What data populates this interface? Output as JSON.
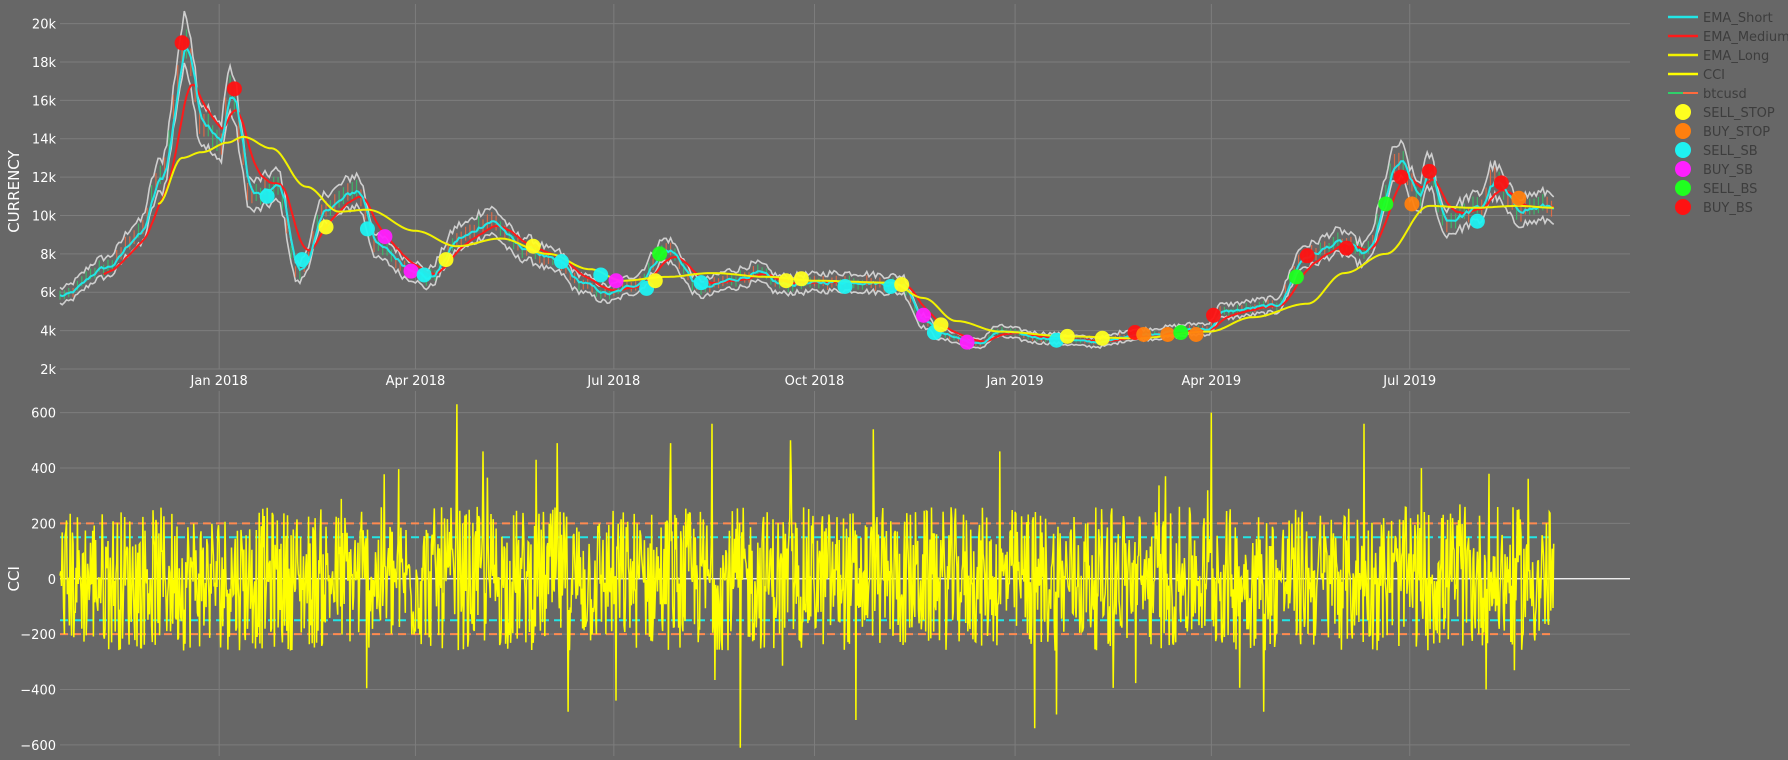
{
  "chart_data": {
    "type": "line",
    "colors": {
      "background": "#676767",
      "grid": "#7d7d7d",
      "ema_short": "#22e6e6",
      "ema_medium": "#ff1a1a",
      "ema_long": "#f2f200",
      "cci": "#ffff00",
      "price_band": "#e2e2e2",
      "cci_threshold_150": "#22e6e6",
      "cci_threshold_200": "#ff8a50",
      "zero_line": "#ffffff"
    },
    "x_ticks": [
      "Jan 2018",
      "Apr 2018",
      "Jul 2018",
      "Oct 2018",
      "Jan 2019",
      "Apr 2019",
      "Jul 2019"
    ],
    "x_tick_dates": [
      "2018-01-01",
      "2018-04-01",
      "2018-07-01",
      "2018-10-01",
      "2019-01-01",
      "2019-04-01",
      "2019-07-01"
    ],
    "xlim": [
      "2017-10-20",
      "2019-10-10"
    ],
    "legend_position": "right",
    "legend": [
      {
        "name": "EMA_Short",
        "kind": "line",
        "color": "#22e6e6"
      },
      {
        "name": "EMA_Medium",
        "kind": "line",
        "color": "#ff1a1a"
      },
      {
        "name": "EMA_Long",
        "kind": "line",
        "color": "#f2f200"
      },
      {
        "name": "CCI",
        "kind": "line",
        "color": "#ffff00"
      },
      {
        "name": "btcusd",
        "kind": "candle",
        "color": "#ff6a3d"
      },
      {
        "name": "SELL_STOP",
        "kind": "marker",
        "color": "#ffff1f"
      },
      {
        "name": "BUY_STOP",
        "kind": "marker",
        "color": "#ff7f0e"
      },
      {
        "name": "SELL_SB",
        "kind": "marker",
        "color": "#1ff2f2"
      },
      {
        "name": "BUY_SB",
        "kind": "marker",
        "color": "#ff1fff"
      },
      {
        "name": "SELL_BS",
        "kind": "marker",
        "color": "#1fff1f"
      },
      {
        "name": "BUY_BS",
        "kind": "marker",
        "color": "#ff1212"
      }
    ],
    "price_panel": {
      "ylabel": "CURRENCY",
      "ylim": [
        2000,
        20500
      ],
      "y_ticks": [
        2000,
        4000,
        6000,
        8000,
        10000,
        12000,
        14000,
        16000,
        18000,
        20000
      ],
      "y_tick_labels": [
        "2k",
        "4k",
        "6k",
        "8k",
        "10k",
        "12k",
        "14k",
        "16k",
        "18k",
        "20k"
      ],
      "price_anchors": [
        [
          "2017-10-20",
          5800
        ],
        [
          "2017-11-10",
          7300
        ],
        [
          "2017-11-25",
          9000
        ],
        [
          "2017-12-05",
          12000
        ],
        [
          "2017-12-17",
          19000
        ],
        [
          "2017-12-24",
          14800
        ],
        [
          "2018-01-01",
          13800
        ],
        [
          "2018-01-06",
          16500
        ],
        [
          "2018-01-16",
          11000
        ],
        [
          "2018-01-28",
          11500
        ],
        [
          "2018-02-06",
          7000
        ],
        [
          "2018-02-20",
          10500
        ],
        [
          "2018-03-05",
          11300
        ],
        [
          "2018-03-15",
          8300
        ],
        [
          "2018-03-30",
          7200
        ],
        [
          "2018-04-06",
          6700
        ],
        [
          "2018-04-22",
          8900
        ],
        [
          "2018-05-05",
          9700
        ],
        [
          "2018-05-20",
          8300
        ],
        [
          "2018-06-05",
          7600
        ],
        [
          "2018-06-15",
          6500
        ],
        [
          "2018-06-28",
          5900
        ],
        [
          "2018-07-10",
          6400
        ],
        [
          "2018-07-25",
          8200
        ],
        [
          "2018-08-10",
          6200
        ],
        [
          "2018-08-25",
          6700
        ],
        [
          "2018-09-05",
          7000
        ],
        [
          "2018-09-15",
          6400
        ],
        [
          "2018-10-15",
          6550
        ],
        [
          "2018-11-10",
          6400
        ],
        [
          "2018-11-20",
          4500
        ],
        [
          "2018-11-28",
          3800
        ],
        [
          "2018-12-15",
          3300
        ],
        [
          "2018-12-24",
          3950
        ],
        [
          "2019-01-15",
          3600
        ],
        [
          "2019-02-08",
          3400
        ],
        [
          "2019-02-25",
          3800
        ],
        [
          "2019-03-31",
          4100
        ],
        [
          "2019-04-05",
          5000
        ],
        [
          "2019-04-30",
          5300
        ],
        [
          "2019-05-14",
          7900
        ],
        [
          "2019-05-30",
          8600
        ],
        [
          "2019-06-10",
          8000
        ],
        [
          "2019-06-26",
          12800
        ],
        [
          "2019-07-05",
          11000
        ],
        [
          "2019-07-10",
          12300
        ],
        [
          "2019-07-17",
          9700
        ],
        [
          "2019-08-02",
          10400
        ],
        [
          "2019-08-08",
          11800
        ],
        [
          "2019-08-20",
          10300
        ],
        [
          "2019-09-05",
          10500
        ]
      ],
      "ema_long_anchors": [
        [
          "2017-12-04",
          10600
        ],
        [
          "2017-12-15",
          13000
        ],
        [
          "2017-12-24",
          13300
        ],
        [
          "2018-01-05",
          13800
        ],
        [
          "2018-01-12",
          14100
        ],
        [
          "2018-01-25",
          13500
        ],
        [
          "2018-02-10",
          11500
        ],
        [
          "2018-02-25",
          10200
        ],
        [
          "2018-03-10",
          10300
        ],
        [
          "2018-04-01",
          9200
        ],
        [
          "2018-04-20",
          8400
        ],
        [
          "2018-05-10",
          8800
        ],
        [
          "2018-06-01",
          8000
        ],
        [
          "2018-06-20",
          7200
        ],
        [
          "2018-07-05",
          6600
        ],
        [
          "2018-07-25",
          6800
        ],
        [
          "2018-08-15",
          7000
        ],
        [
          "2018-09-10",
          6800
        ],
        [
          "2018-10-01",
          6600
        ],
        [
          "2018-11-05",
          6500
        ],
        [
          "2018-11-20",
          5700
        ],
        [
          "2018-12-05",
          4500
        ],
        [
          "2018-12-25",
          3950
        ],
        [
          "2019-01-25",
          3700
        ],
        [
          "2019-02-25",
          3600
        ],
        [
          "2019-03-31",
          3950
        ],
        [
          "2019-04-20",
          4700
        ],
        [
          "2019-05-15",
          5400
        ],
        [
          "2019-06-01",
          7000
        ],
        [
          "2019-06-20",
          8000
        ],
        [
          "2019-07-10",
          10500
        ],
        [
          "2019-07-30",
          10400
        ],
        [
          "2019-08-20",
          10500
        ],
        [
          "2019-09-05",
          10400
        ]
      ],
      "signals": [
        {
          "type": "BUY_BS",
          "date": "2017-12-15",
          "value": 19000
        },
        {
          "type": "BUY_BS",
          "date": "2018-01-08",
          "value": 16600
        },
        {
          "type": "SELL_SB",
          "date": "2018-01-23",
          "value": 11000
        },
        {
          "type": "SELL_SB",
          "date": "2018-02-08",
          "value": 7700
        },
        {
          "type": "SELL_STOP",
          "date": "2018-02-19",
          "value": 9400
        },
        {
          "type": "SELL_SB",
          "date": "2018-03-10",
          "value": 9300
        },
        {
          "type": "BUY_SB",
          "date": "2018-03-18",
          "value": 8900
        },
        {
          "type": "BUY_SB",
          "date": "2018-03-30",
          "value": 7100
        },
        {
          "type": "SELL_SB",
          "date": "2018-04-05",
          "value": 6900
        },
        {
          "type": "SELL_STOP",
          "date": "2018-04-15",
          "value": 7700
        },
        {
          "type": "SELL_STOP",
          "date": "2018-05-25",
          "value": 8400
        },
        {
          "type": "SELL_SB",
          "date": "2018-06-07",
          "value": 7600
        },
        {
          "type": "SELL_SB",
          "date": "2018-06-25",
          "value": 6900
        },
        {
          "type": "BUY_SB",
          "date": "2018-07-02",
          "value": 6600
        },
        {
          "type": "SELL_SB",
          "date": "2018-07-16",
          "value": 6200
        },
        {
          "type": "SELL_BS",
          "date": "2018-07-22",
          "value": 8000
        },
        {
          "type": "SELL_STOP",
          "date": "2018-07-20",
          "value": 6600
        },
        {
          "type": "SELL_SB",
          "date": "2018-08-10",
          "value": 6500
        },
        {
          "type": "SELL_STOP",
          "date": "2018-09-18",
          "value": 6600
        },
        {
          "type": "SELL_STOP",
          "date": "2018-09-25",
          "value": 6700
        },
        {
          "type": "SELL_SB",
          "date": "2018-10-15",
          "value": 6300
        },
        {
          "type": "SELL_SB",
          "date": "2018-11-05",
          "value": 6300
        },
        {
          "type": "SELL_STOP",
          "date": "2018-11-10",
          "value": 6400
        },
        {
          "type": "BUY_SB",
          "date": "2018-11-20",
          "value": 4800
        },
        {
          "type": "SELL_SB",
          "date": "2018-11-25",
          "value": 3900
        },
        {
          "type": "SELL_STOP",
          "date": "2018-11-28",
          "value": 4300
        },
        {
          "type": "BUY_SB",
          "date": "2018-12-10",
          "value": 3400
        },
        {
          "type": "SELL_SB",
          "date": "2019-01-20",
          "value": 3500
        },
        {
          "type": "SELL_STOP",
          "date": "2019-01-25",
          "value": 3700
        },
        {
          "type": "SELL_STOP",
          "date": "2019-02-10",
          "value": 3600
        },
        {
          "type": "BUY_BS",
          "date": "2019-02-25",
          "value": 3900
        },
        {
          "type": "BUY_STOP",
          "date": "2019-03-01",
          "value": 3800
        },
        {
          "type": "BUY_STOP",
          "date": "2019-03-12",
          "value": 3800
        },
        {
          "type": "SELL_BS",
          "date": "2019-03-18",
          "value": 3900
        },
        {
          "type": "BUY_STOP",
          "date": "2019-03-25",
          "value": 3800
        },
        {
          "type": "BUY_BS",
          "date": "2019-04-02",
          "value": 4800
        },
        {
          "type": "SELL_BS",
          "date": "2019-05-10",
          "value": 6800
        },
        {
          "type": "BUY_BS",
          "date": "2019-05-15",
          "value": 7900
        },
        {
          "type": "BUY_BS",
          "date": "2019-06-02",
          "value": 8300
        },
        {
          "type": "SELL_BS",
          "date": "2019-06-20",
          "value": 10600
        },
        {
          "type": "BUY_BS",
          "date": "2019-06-27",
          "value": 12000
        },
        {
          "type": "BUY_STOP",
          "date": "2019-07-02",
          "value": 10600
        },
        {
          "type": "BUY_BS",
          "date": "2019-07-10",
          "value": 12300
        },
        {
          "type": "SELL_SB",
          "date": "2019-08-01",
          "value": 9700
        },
        {
          "type": "BUY_BS",
          "date": "2019-08-12",
          "value": 11700
        },
        {
          "type": "BUY_STOP",
          "date": "2019-08-20",
          "value": 10900
        }
      ]
    },
    "cci_panel": {
      "ylabel": "CCI",
      "ylim": [
        -640,
        660
      ],
      "y_ticks": [
        -600,
        -400,
        -200,
        0,
        200,
        400,
        600
      ],
      "y_tick_labels": [
        "−600",
        "−400",
        "−200",
        "0",
        "200",
        "400",
        "600"
      ],
      "thresholds": [
        {
          "value": 200,
          "color": "#ff8a50"
        },
        {
          "value": 150,
          "color": "#22e6e6"
        },
        {
          "value": -150,
          "color": "#22e6e6"
        },
        {
          "value": -200,
          "color": "#ff8a50"
        }
      ],
      "spikes": [
        [
          "2018-04-20",
          630
        ],
        [
          "2018-05-02",
          460
        ],
        [
          "2018-06-05",
          490
        ],
        [
          "2018-06-10",
          -480
        ],
        [
          "2018-07-02",
          -440
        ],
        [
          "2018-07-27",
          490
        ],
        [
          "2018-08-15",
          560
        ],
        [
          "2018-08-28",
          -610
        ],
        [
          "2018-09-20",
          500
        ],
        [
          "2018-10-20",
          -510
        ],
        [
          "2018-10-28",
          540
        ],
        [
          "2018-12-25",
          460
        ],
        [
          "2019-01-10",
          -540
        ],
        [
          "2019-01-20",
          -490
        ],
        [
          "2019-04-01",
          600
        ],
        [
          "2019-04-25",
          -480
        ],
        [
          "2019-06-10",
          560
        ],
        [
          "2019-08-05",
          -400
        ],
        [
          "2019-08-18",
          -330
        ]
      ]
    }
  }
}
